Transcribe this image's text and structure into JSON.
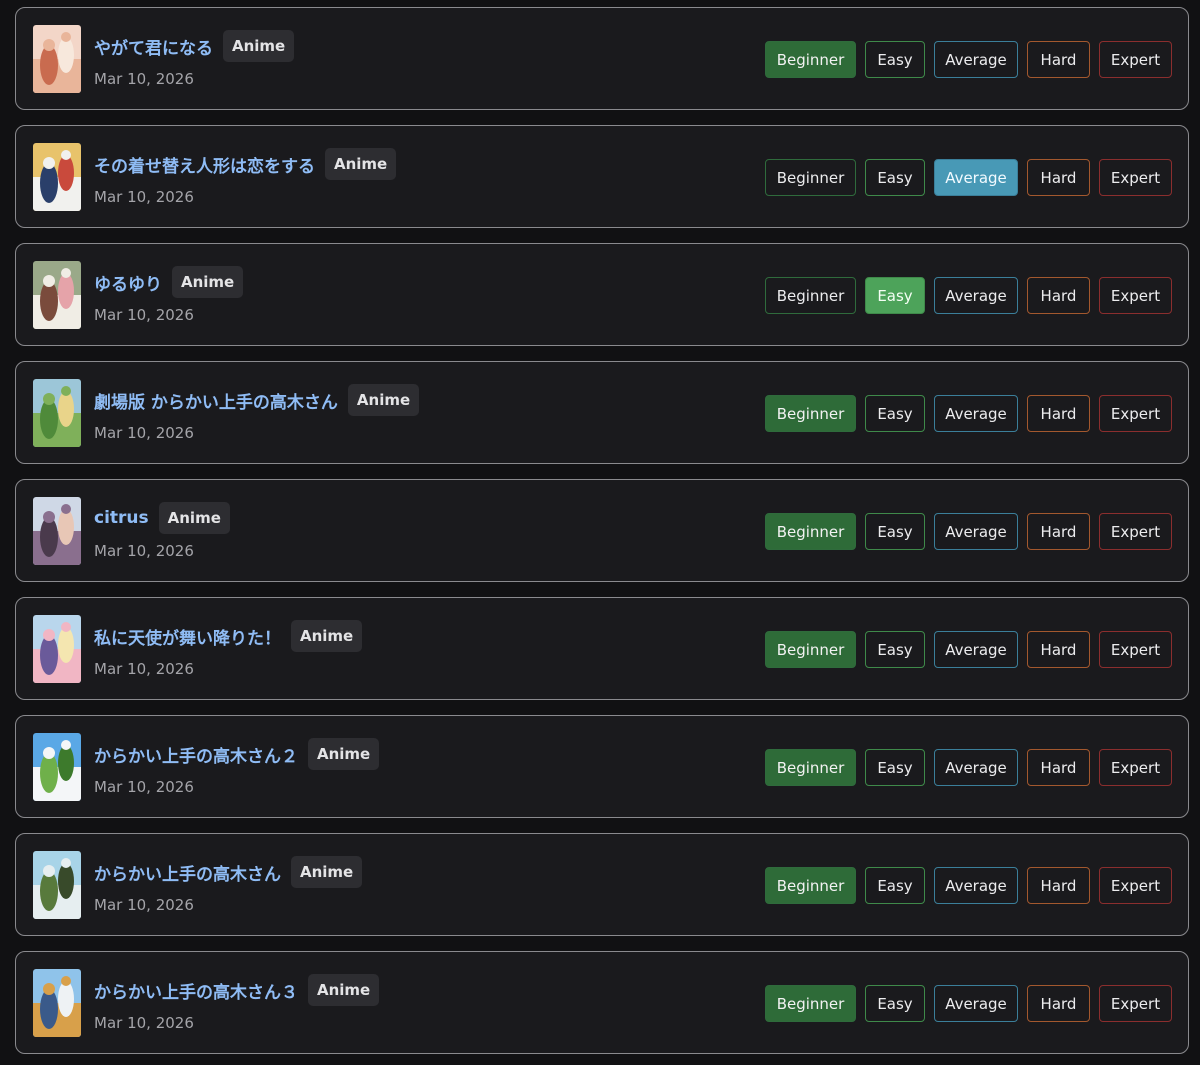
{
  "level_labels": [
    "Beginner",
    "Easy",
    "Average",
    "Hard",
    "Expert"
  ],
  "items": [
    {
      "title": "やがて君になる",
      "badge": "Anime",
      "date": "Mar 10, 2026",
      "selected": "Beginner",
      "thumb_colors": [
        "#f3d6c8",
        "#e9b59a",
        "#c96b4f",
        "#f7e8dc"
      ]
    },
    {
      "title": "その着せ替え人形は恋をする",
      "badge": "Anime",
      "date": "Mar 10, 2026",
      "selected": "Average",
      "thumb_colors": [
        "#e8c36b",
        "#f1f1ee",
        "#2a3f6a",
        "#c94a3c"
      ]
    },
    {
      "title": "ゆるゆり",
      "badge": "Anime",
      "date": "Mar 10, 2026",
      "selected": "Easy",
      "thumb_colors": [
        "#9aa989",
        "#f0ede5",
        "#7a4b3c",
        "#e5a3a9"
      ]
    },
    {
      "title": "劇場版 からかい上手の高木さん",
      "badge": "Anime",
      "date": "Mar 10, 2026",
      "selected": "Beginner",
      "thumb_colors": [
        "#9cc6d8",
        "#7fb05a",
        "#4f8a3a",
        "#e9d48a"
      ]
    },
    {
      "title": "citrus",
      "badge": "Anime",
      "date": "Mar 10, 2026",
      "selected": "Beginner",
      "thumb_colors": [
        "#cfd8e6",
        "#8a6f8e",
        "#4a3a4c",
        "#e8c7b6"
      ]
    },
    {
      "title": "私に天使が舞い降りた！",
      "badge": "Anime",
      "date": "Mar 10, 2026",
      "selected": "Beginner",
      "thumb_colors": [
        "#b9d6ec",
        "#f1b6c4",
        "#6a5a9a",
        "#f4e6b0"
      ]
    },
    {
      "title": "からかい上手の高木さん２",
      "badge": "Anime",
      "date": "Mar 10, 2026",
      "selected": "Beginner",
      "thumb_colors": [
        "#5aa8e6",
        "#f4f6f8",
        "#6fb04a",
        "#3d7a2c"
      ]
    },
    {
      "title": "からかい上手の高木さん",
      "badge": "Anime",
      "date": "Mar 10, 2026",
      "selected": "Beginner",
      "thumb_colors": [
        "#a8d4e8",
        "#e6eef0",
        "#587a3c",
        "#384a2a"
      ]
    },
    {
      "title": "からかい上手の高木さん３",
      "badge": "Anime",
      "date": "Mar 10, 2026",
      "selected": "Beginner",
      "thumb_colors": [
        "#8fc3ea",
        "#d8a04a",
        "#3a5a8a",
        "#eef2f4"
      ]
    }
  ]
}
